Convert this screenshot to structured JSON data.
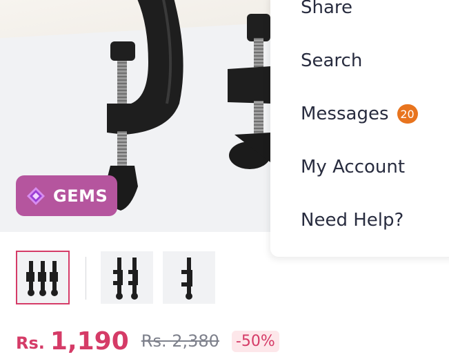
{
  "gems_badge": {
    "label": "GEMS",
    "icon": "diamond-gem-icon",
    "color": "#b5559e"
  },
  "menu": {
    "items": [
      {
        "label": "Share"
      },
      {
        "label": "Search"
      },
      {
        "label": "Messages",
        "badge": "20"
      },
      {
        "label": "My Account"
      },
      {
        "label": "Need Help?"
      }
    ]
  },
  "gallery": {
    "thumbnails": [
      {
        "label": "thumbnail-1",
        "selected": true
      },
      {
        "label": "thumbnail-2",
        "selected": false
      },
      {
        "label": "thumbnail-3",
        "selected": false
      }
    ]
  },
  "pricing": {
    "currency_prefix": "Rs.",
    "price": "1,190",
    "mrp": "Rs. 2,380",
    "discount": "-50%",
    "accent_color": "#d53b67"
  }
}
